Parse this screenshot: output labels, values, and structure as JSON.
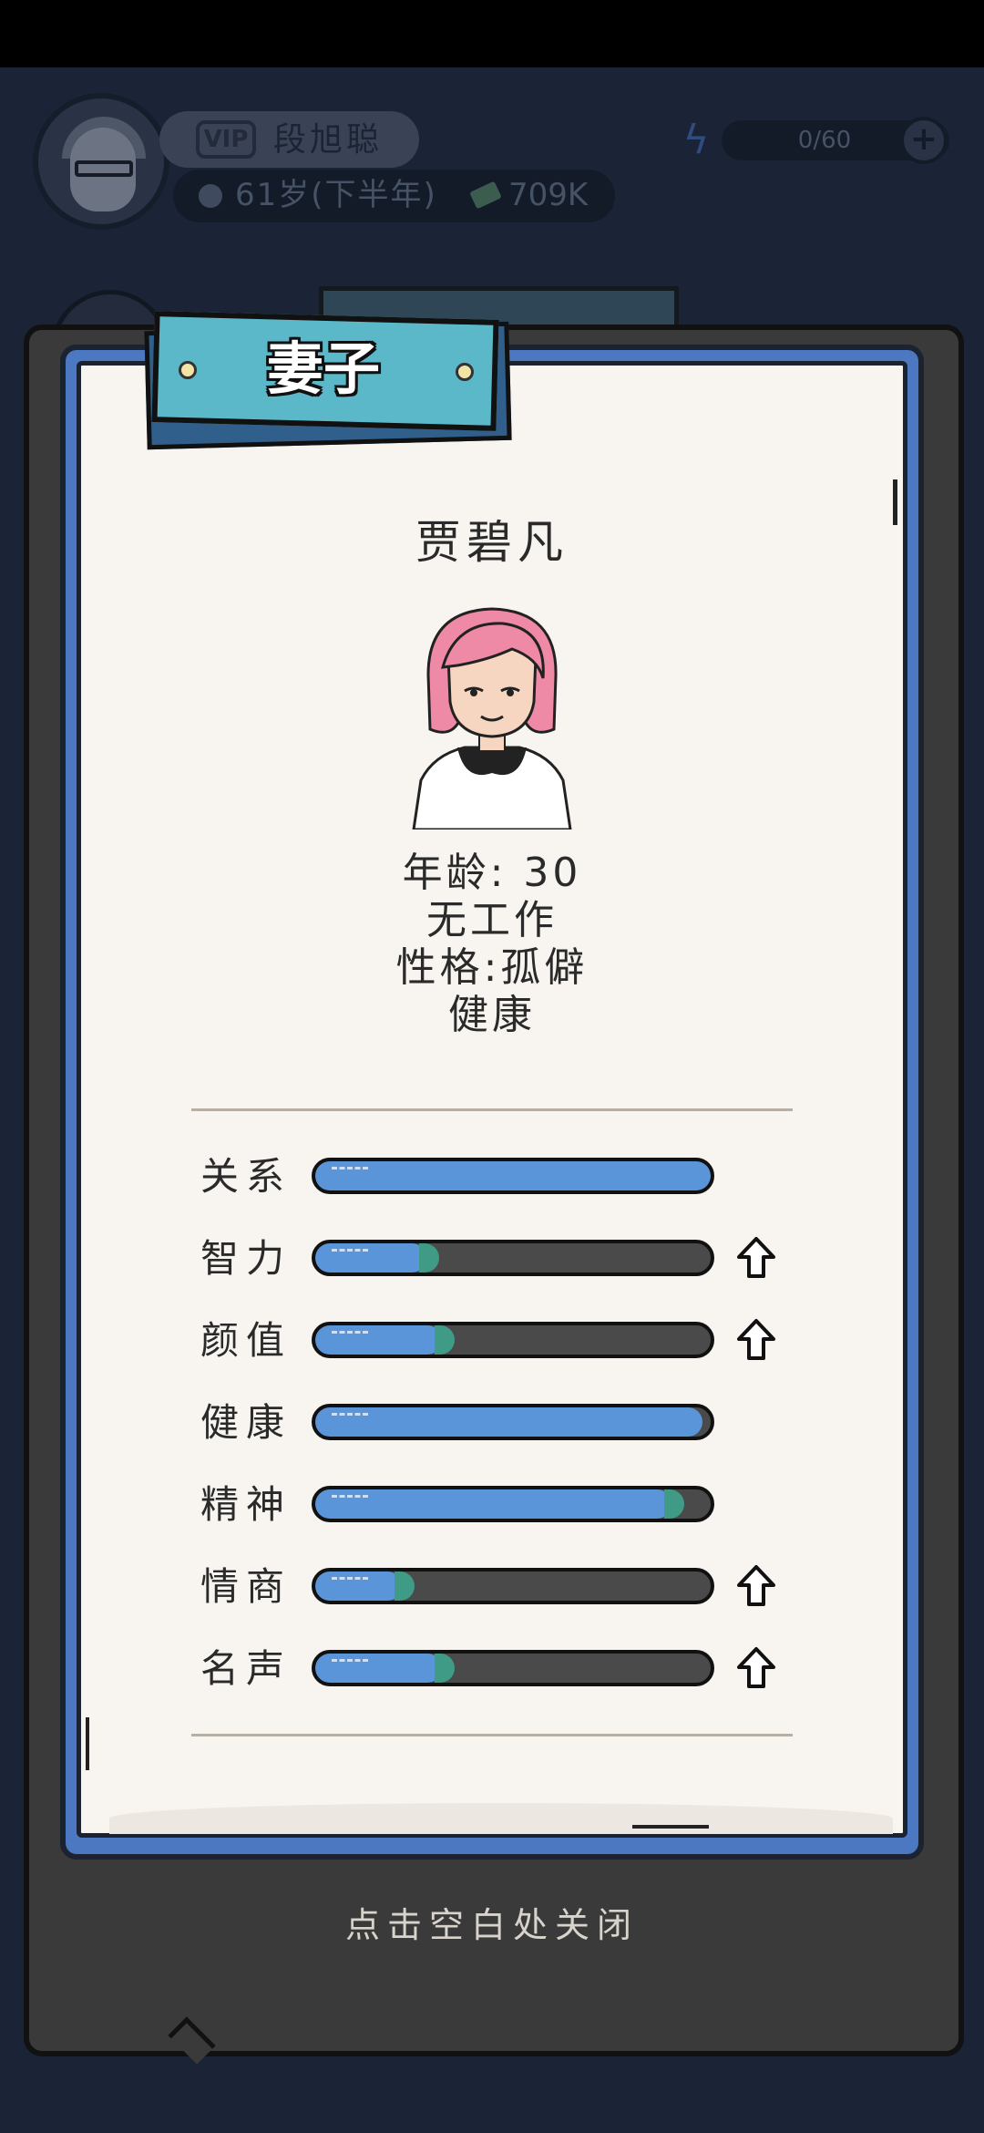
{
  "hud": {
    "vip_label": "VIP",
    "player_name": "段旭聪",
    "age": "61岁(下半年)",
    "cash": "709K",
    "energy": "0/60",
    "plus_symbol": "+",
    "energy_symbol": "ϟ"
  },
  "dialog": {
    "title": "妻子",
    "spouse_name": "贾碧凡",
    "age_line": "年龄: 30",
    "job_line": "无工作",
    "personality_line": "性格:孤僻",
    "health_line": "健康",
    "close_hint": "点击空白处关闭"
  },
  "stats": [
    {
      "label": "关系",
      "level": 1.0,
      "upgradeable": false
    },
    {
      "label": "智力",
      "level": 0.28,
      "upgradeable": true
    },
    {
      "label": "颜值",
      "level": 0.32,
      "upgradeable": true
    },
    {
      "label": "健康",
      "level": 0.98,
      "upgradeable": false
    },
    {
      "label": "精神",
      "level": 0.9,
      "upgradeable": false
    },
    {
      "label": "情商",
      "level": 0.22,
      "upgradeable": true
    },
    {
      "label": "名声",
      "level": 0.32,
      "upgradeable": true
    }
  ],
  "colors": {
    "bar_fill": "#5b95d9",
    "bar_tip": "#3f9a86",
    "panel_blue": "#4b78c0",
    "banner_teal": "#5ab8c8",
    "hair_pink": "#ee8aa6"
  }
}
